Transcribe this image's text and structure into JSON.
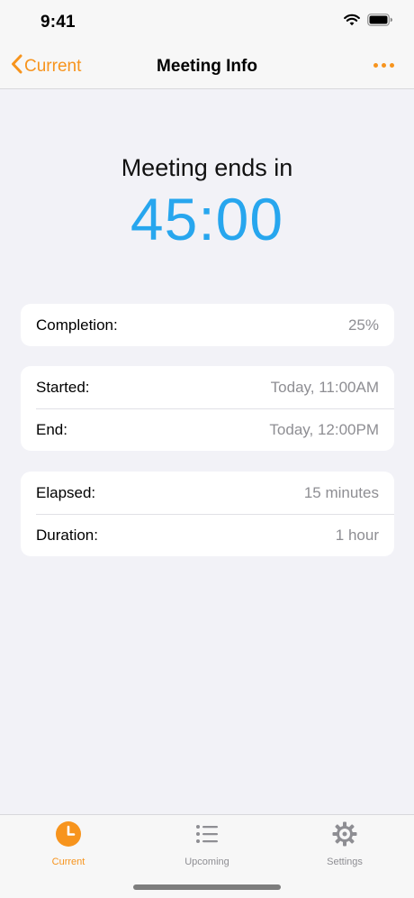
{
  "status_bar": {
    "time": "9:41"
  },
  "nav": {
    "back_label": "Current",
    "title": "Meeting Info"
  },
  "countdown": {
    "label": "Meeting ends in",
    "value": "45:00"
  },
  "cards": [
    {
      "rows": [
        {
          "label": "Completion:",
          "value": "25%"
        }
      ]
    },
    {
      "rows": [
        {
          "label": "Started:",
          "value": "Today, 11:00AM"
        },
        {
          "label": "End:",
          "value": "Today, 12:00PM"
        }
      ]
    },
    {
      "rows": [
        {
          "label": "Elapsed:",
          "value": "15 minutes"
        },
        {
          "label": "Duration:",
          "value": "1 hour"
        }
      ]
    }
  ],
  "tabs": [
    {
      "label": "Current",
      "icon": "clock-icon",
      "active": true
    },
    {
      "label": "Upcoming",
      "icon": "list-icon",
      "active": false
    },
    {
      "label": "Settings",
      "icon": "gear-icon",
      "active": false
    }
  ],
  "colors": {
    "accent": "#f7941d",
    "countdown": "#27a6ee",
    "secondary_text": "#8e8e93",
    "background": "#f2f2f7"
  }
}
